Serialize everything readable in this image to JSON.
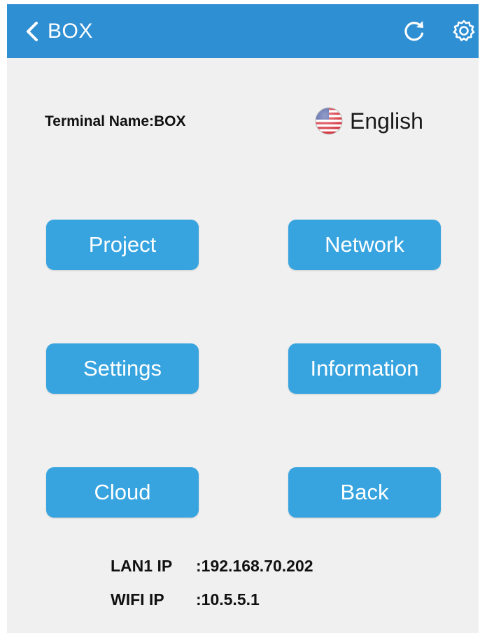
{
  "header": {
    "title": "BOX",
    "back_icon": "chevron-left-icon",
    "refresh_icon": "refresh-icon",
    "settings_icon": "gear-icon",
    "color": "#2f8fd3"
  },
  "terminal": {
    "label": "Terminal Name:BOX"
  },
  "language": {
    "label": "English",
    "flag_icon": "us-flag-icon"
  },
  "buttons": {
    "project": "Project",
    "network": "Network",
    "settings": "Settings",
    "information": "Information",
    "cloud": "Cloud",
    "back": "Back",
    "color": "#37a4e0"
  },
  "network_info": {
    "lan1_label": "LAN1 IP",
    "lan1_value": ":192.168.70.202",
    "wifi_label": "WIFI IP",
    "wifi_value": ":10.5.5.1"
  }
}
